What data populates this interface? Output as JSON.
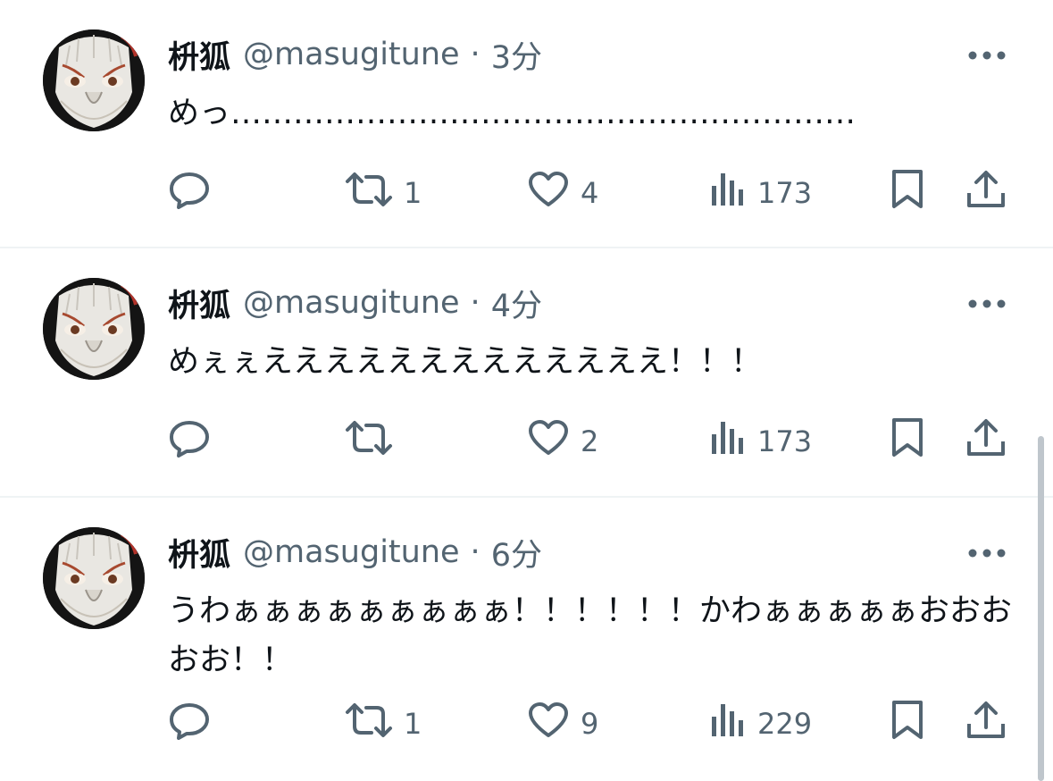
{
  "tweets": [
    {
      "author_name": "枡狐",
      "handle": "@masugitune",
      "separator": "·",
      "time": "3分",
      "text": "めっ……………………………………………………",
      "retweets": "1",
      "likes": "4",
      "views": "173"
    },
    {
      "author_name": "枡狐",
      "handle": "@masugitune",
      "separator": "·",
      "time": "4分",
      "text": "めぇぇえええええええええええええ！！！",
      "retweets": "",
      "likes": "2",
      "views": "173"
    },
    {
      "author_name": "枡狐",
      "handle": "@masugitune",
      "separator": "·",
      "time": "6分",
      "text": "うわぁぁぁぁぁぁぁぁぁ！！！！！！かわぁぁぁぁぁおおおおお！！",
      "retweets": "1",
      "likes": "9",
      "views": "229"
    }
  ],
  "icons": {
    "avatar": "fox-mask-avatar",
    "more": "more-options-icon",
    "reply": "reply-icon",
    "retweet": "retweet-icon",
    "like": "heart-icon",
    "views": "views-chart-icon",
    "bookmark": "bookmark-icon",
    "share": "share-icon"
  },
  "colors": {
    "text_primary": "#0f1419",
    "text_secondary": "#536471",
    "divider": "#eff3f4"
  }
}
